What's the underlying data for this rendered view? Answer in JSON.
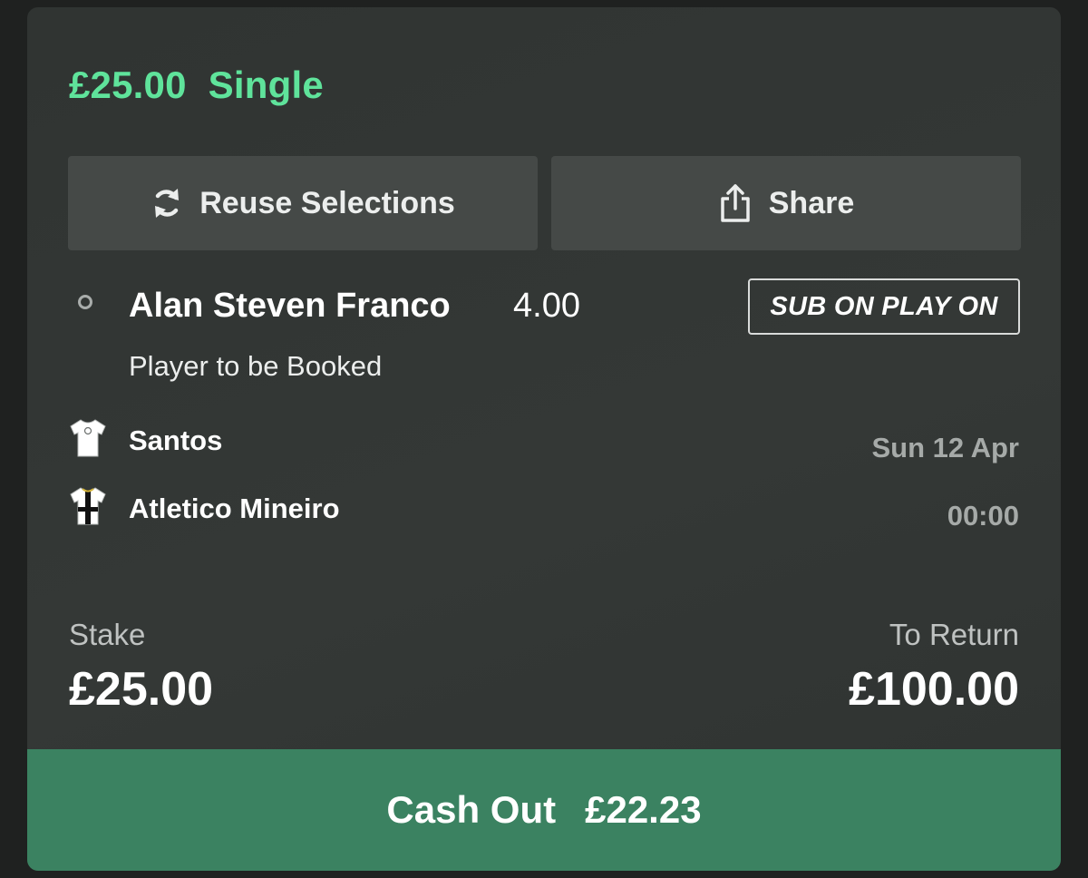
{
  "bet": {
    "amount": "£25.00",
    "type": "Single"
  },
  "actions": {
    "reuse_label": "Reuse Selections",
    "reuse_icon": "refresh-icon",
    "share_label": "Share",
    "share_icon": "share-icon"
  },
  "selection": {
    "name": "Alan Steven Franco",
    "odds": "4.00",
    "badge": "SUB ON PLAY ON",
    "market": "Player to be Booked"
  },
  "event": {
    "home_team": "Santos",
    "away_team": "Atletico Mineiro",
    "date": "Sun 12 Apr",
    "time": "00:00"
  },
  "totals": {
    "stake_label": "Stake",
    "stake_value": "£25.00",
    "return_label": "To Return",
    "return_value": "£100.00"
  },
  "cashout": {
    "label": "Cash Out",
    "amount": "£22.23"
  },
  "colors": {
    "accent_green": "#5fe39b",
    "cashout_green": "#3b8261",
    "card_bg": "#323634"
  }
}
